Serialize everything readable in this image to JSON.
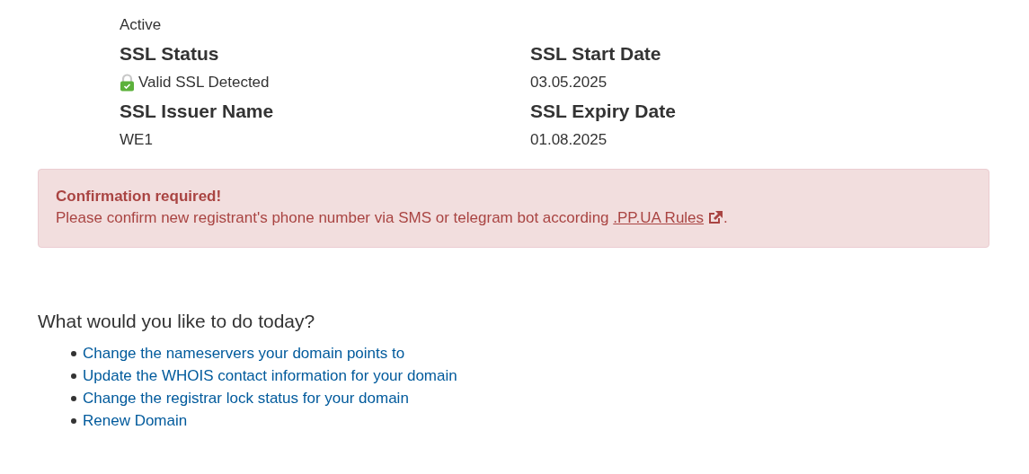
{
  "status": "Active",
  "ssl_fields": [
    {
      "label": "SSL Status",
      "value": "Valid SSL Detected",
      "kind": "ssl"
    },
    {
      "label": "SSL Start Date",
      "value": "03.05.2025",
      "kind": "text"
    },
    {
      "label": "SSL Issuer Name",
      "value": "WE1",
      "kind": "text"
    },
    {
      "label": "SSL Expiry Date",
      "value": "01.08.2025",
      "kind": "text"
    }
  ],
  "alert": {
    "title": "Confirmation required!",
    "message": "Please confirm new registrant's phone number via SMS or telegram bot according",
    "link": ".PP.UA Rules",
    "end": "."
  },
  "actions": {
    "heading": "What would you like to do today?",
    "links": [
      "Change the nameservers your domain points to",
      "Update the WHOIS contact information for your domain",
      "Change the registrar lock status for your domain",
      "Renew Domain"
    ]
  }
}
